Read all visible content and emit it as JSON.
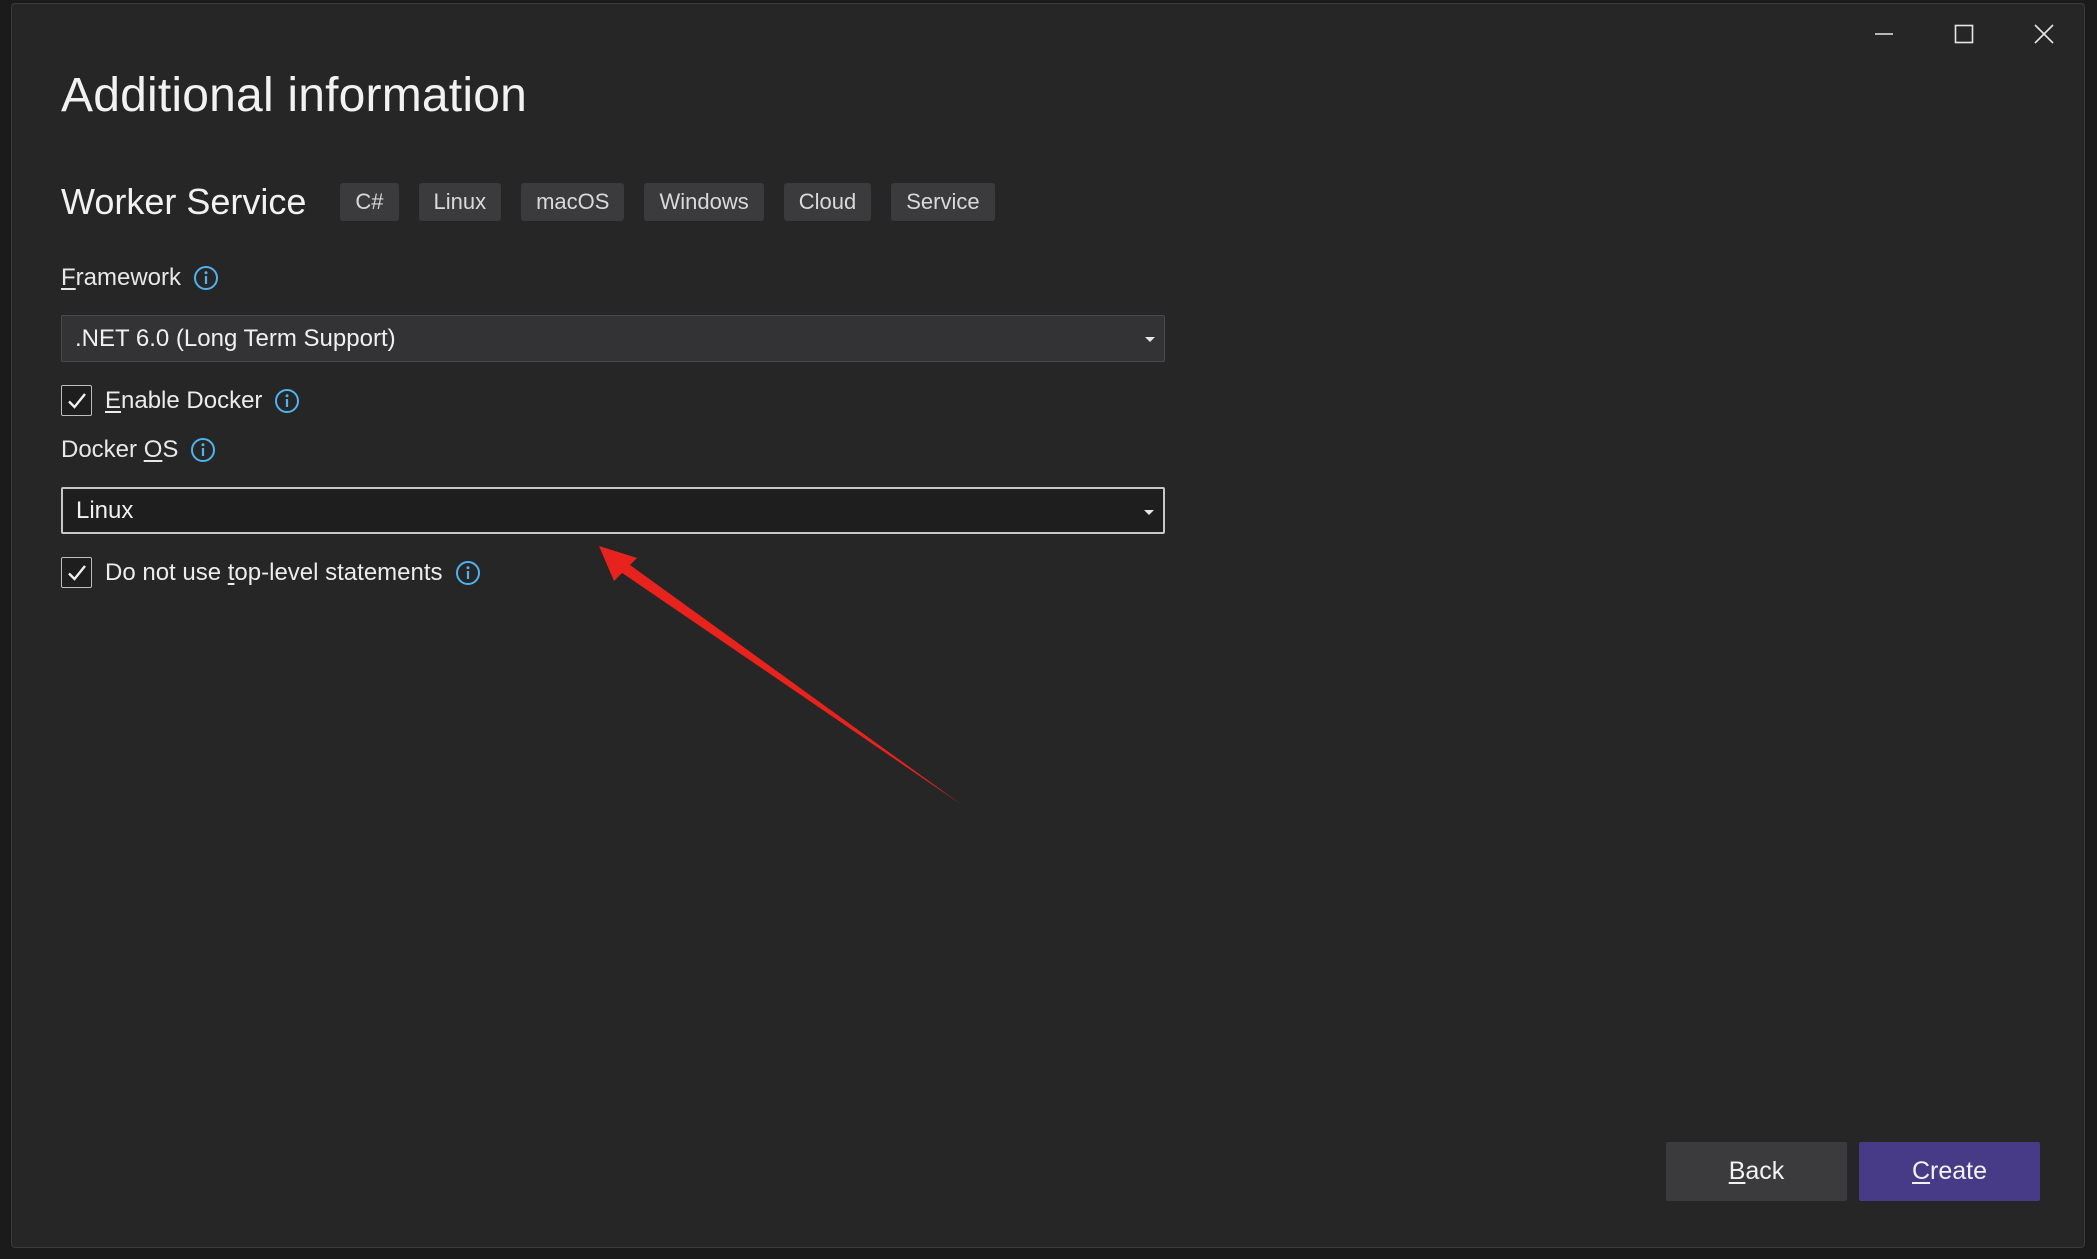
{
  "dialog": {
    "title": "Additional information",
    "template_name": "Worker Service",
    "tags": [
      "C#",
      "Linux",
      "macOS",
      "Windows",
      "Cloud",
      "Service"
    ]
  },
  "framework": {
    "label": "Framework",
    "label_underline": "F",
    "label_rest": "ramework",
    "selected": ".NET 6.0 (Long Term Support)"
  },
  "enable_docker": {
    "label": "Enable Docker",
    "label_underline": "E",
    "label_rest": "nable Docker",
    "checked": true
  },
  "docker_os": {
    "label": "Docker OS",
    "label_prefix": "Docker ",
    "label_underline": "O",
    "label_rest": "S",
    "selected": "Linux"
  },
  "top_level": {
    "label": "Do not use top-level statements",
    "label_prefix": "Do not use ",
    "label_underline": "t",
    "label_rest": "op-level statements",
    "checked": true
  },
  "buttons": {
    "back": "Back",
    "back_underline": "B",
    "back_rest": "ack",
    "create": "Create",
    "create_underline": "C",
    "create_rest": "reate"
  },
  "colors": {
    "background": "#262627",
    "accent_button": "#473a87",
    "info_icon": "#4fb3f0",
    "annotation_arrow": "#e8231e"
  },
  "icons": [
    "minimize-icon",
    "maximize-icon",
    "close-icon",
    "info-icon",
    "checkmark-icon",
    "dropdown-caret-icon"
  ]
}
